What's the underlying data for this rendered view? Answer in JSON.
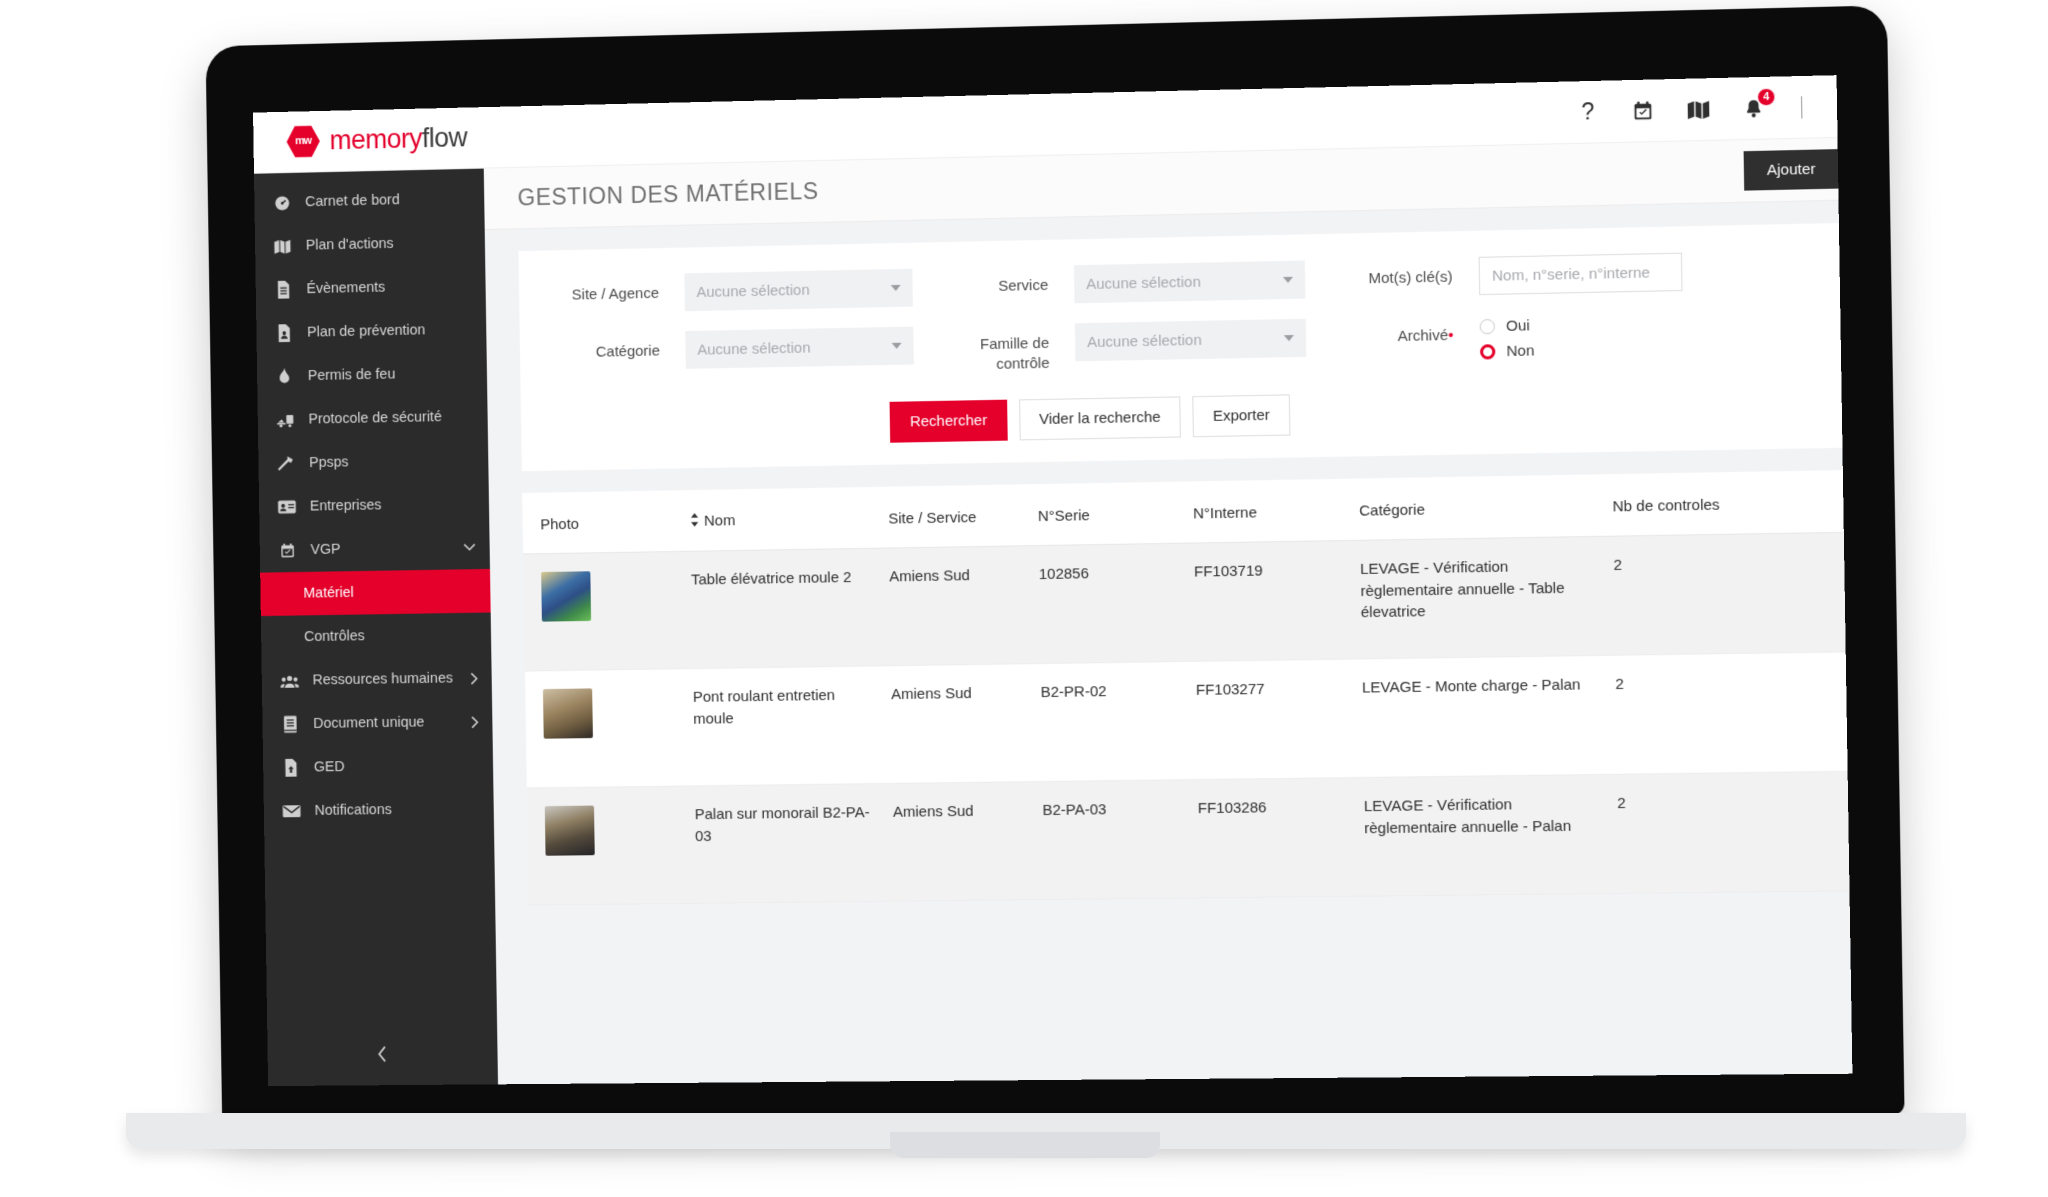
{
  "brand": {
    "hex_text": "mw",
    "name_part1": "memory",
    "name_part2": "flow"
  },
  "topbar": {
    "help_icon": "question-mark-icon",
    "calendar_icon": "calendar-check-icon",
    "map_icon": "map-icon",
    "bell_icon": "bell-icon",
    "notification_count": "4"
  },
  "sidebar": {
    "items": [
      {
        "label": "Carnet de bord",
        "icon": "dashboard-icon",
        "has_chevron": false
      },
      {
        "label": "Plan d'actions",
        "icon": "map-icon",
        "has_chevron": false
      },
      {
        "label": "Évènements",
        "icon": "document-icon",
        "has_chevron": false
      },
      {
        "label": "Plan de prévention",
        "icon": "document-user-icon",
        "has_chevron": false
      },
      {
        "label": "Permis de feu",
        "icon": "flame-icon",
        "has_chevron": false
      },
      {
        "label": "Protocole de sécurité",
        "icon": "truck-icon",
        "has_chevron": false
      },
      {
        "label": "Ppsps",
        "icon": "hammer-icon",
        "has_chevron": false
      },
      {
        "label": "Entreprises",
        "icon": "id-card-icon",
        "has_chevron": false
      },
      {
        "label": "VGP",
        "icon": "calendar-check-icon",
        "has_chevron": true
      }
    ],
    "sub_items": [
      {
        "label": "Matériel",
        "active": true
      },
      {
        "label": "Contrôles",
        "active": false
      }
    ],
    "items_after": [
      {
        "label": "Ressources humaines",
        "icon": "people-icon",
        "has_chevron": true
      },
      {
        "label": "Document unique",
        "icon": "book-icon",
        "has_chevron": true
      },
      {
        "label": "GED",
        "icon": "file-upload-icon",
        "has_chevron": false
      },
      {
        "label": "Notifications",
        "icon": "envelope-icon",
        "has_chevron": false
      }
    ],
    "collapse_icon": "chevron-left-icon"
  },
  "page": {
    "title": "GESTION DES MATÉRIELS",
    "add_button": "Ajouter"
  },
  "filters": {
    "site_label": "Site / Agence",
    "site_value": "Aucune sélection",
    "service_label": "Service",
    "service_value": "Aucune sélection",
    "keywords_label": "Mot(s) clé(s)",
    "keywords_placeholder": "Nom, n°serie, n°interne",
    "category_label": "Catégorie",
    "category_value": "Aucune sélection",
    "family_label": "Famille de contrôle",
    "family_value": "Aucune sélection",
    "archived_label": "Archivé",
    "archived_required_mark": "•",
    "archived_yes": "Oui",
    "archived_no": "Non",
    "archived_selected": "Non",
    "btn_search": "Rechercher",
    "btn_clear": "Vider la recherche",
    "btn_export": "Exporter"
  },
  "table": {
    "headers": {
      "photo": "Photo",
      "nom": "Nom",
      "site_service": "Site / Service",
      "serie": "N°Serie",
      "interne": "N°Interne",
      "categorie": "Catégorie",
      "nb_controles": "Nb de controles"
    },
    "rows": [
      {
        "thumb": "t1",
        "nom": "Table élévatrice moule 2",
        "site": "Amiens Sud",
        "serie": "102856",
        "interne": "FF103719",
        "categorie": "LEVAGE - Vérification règlementaire annuelle - Table élevatrice",
        "nb": "2"
      },
      {
        "thumb": "t2",
        "nom": "Pont roulant entretien moule",
        "site": "Amiens Sud",
        "serie": "B2-PR-02",
        "interne": "FF103277",
        "categorie": "LEVAGE - Monte charge - Palan",
        "nb": "2"
      },
      {
        "thumb": "t3",
        "nom": "Palan sur monorail B2-PA-03",
        "site": "Amiens Sud",
        "serie": "B2-PA-03",
        "interne": "FF103286",
        "categorie": "LEVAGE - Vérification règlementaire annuelle - Palan",
        "nb": "2"
      }
    ]
  },
  "colors": {
    "accent_red": "#e4002b",
    "sidebar_bg": "#2b2b2b",
    "dark_button": "#2f2f2f"
  }
}
